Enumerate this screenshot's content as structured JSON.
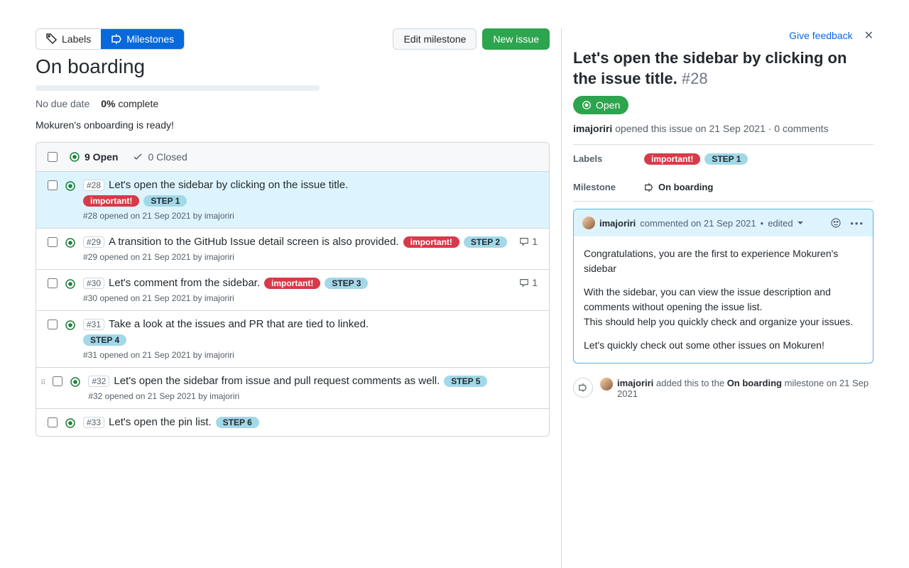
{
  "toolbar": {
    "labels_tab": "Labels",
    "milestones_tab": "Milestones",
    "edit_btn": "Edit milestone",
    "new_btn": "New issue"
  },
  "milestone": {
    "title": "On boarding",
    "due": "No due date",
    "pct_num": "0%",
    "pct_word": "complete",
    "description": "Mokuren's onboarding is ready!"
  },
  "list_header": {
    "open": "9 Open",
    "closed": "0 Closed"
  },
  "issues": [
    {
      "num": "#28",
      "title": "Let's open the sidebar by clicking on the issue title.",
      "labels": [
        {
          "t": "important!",
          "c": "red"
        },
        {
          "t": "STEP 1",
          "c": "blue"
        }
      ],
      "sub": "#28 opened on 21 Sep 2021 by imajoriri",
      "comments": null,
      "selected": true
    },
    {
      "num": "#29",
      "title": "A transition to the GitHub Issue detail screen is also provided.",
      "labels": [
        {
          "t": "important!",
          "c": "red"
        },
        {
          "t": "STEP 2",
          "c": "blue"
        }
      ],
      "sub": "#29 opened on 21 Sep 2021 by imajoriri",
      "comments": "1",
      "inline_labels": true
    },
    {
      "num": "#30",
      "title": "Let's comment from the sidebar.",
      "labels": [
        {
          "t": "important!",
          "c": "red"
        },
        {
          "t": "STEP 3",
          "c": "blue"
        }
      ],
      "sub": "#30 opened on 21 Sep 2021 by imajoriri",
      "comments": "1",
      "inline_labels": true
    },
    {
      "num": "#31",
      "title": "Take a look at the issues and PR that are tied to linked.",
      "labels": [
        {
          "t": "STEP 4",
          "c": "blue"
        }
      ],
      "sub": "#31 opened on 21 Sep 2021 by imajoriri",
      "comments": null
    },
    {
      "num": "#32",
      "title": "Let's open the sidebar from issue and pull request comments as well.",
      "labels": [
        {
          "t": "STEP 5",
          "c": "blue"
        }
      ],
      "sub": "#32 opened on 21 Sep 2021 by imajoriri",
      "comments": null,
      "drag": true,
      "inline_labels": true
    },
    {
      "num": "#33",
      "title": "Let's open the pin list.",
      "labels": [
        {
          "t": "STEP 6",
          "c": "blue"
        }
      ],
      "sub": "",
      "comments": null,
      "inline_labels": true
    }
  ],
  "sidebar": {
    "feedback": "Give feedback",
    "title": "Let's open the sidebar by clicking on the issue title.",
    "num": "#28",
    "state": "Open",
    "meta_author": "imajoriri",
    "meta_rest": "opened this issue on 21 Sep 2021 · 0 comments",
    "labels_key": "Labels",
    "labels": [
      {
        "t": "important!",
        "c": "red"
      },
      {
        "t": "STEP 1",
        "c": "blue"
      }
    ],
    "milestone_key": "Milestone",
    "milestone_val": "On boarding",
    "comment": {
      "author": "imajoriri",
      "meta": "commented on 21 Sep 2021",
      "edited": "edited",
      "p1": "Congratulations, you are the first to experience Mokuren's sidebar",
      "p2a": "With the sidebar, you can view the issue description and comments without opening the issue list.",
      "p2b": "This should help you quickly check and organize your issues.",
      "p3": "Let's quickly check out some other issues on Mokuren!"
    },
    "timeline": {
      "author": "imajoriri",
      "text1": "added this to the",
      "milestone": "On boarding",
      "text2": "milestone on 21 Sep 2021"
    }
  }
}
